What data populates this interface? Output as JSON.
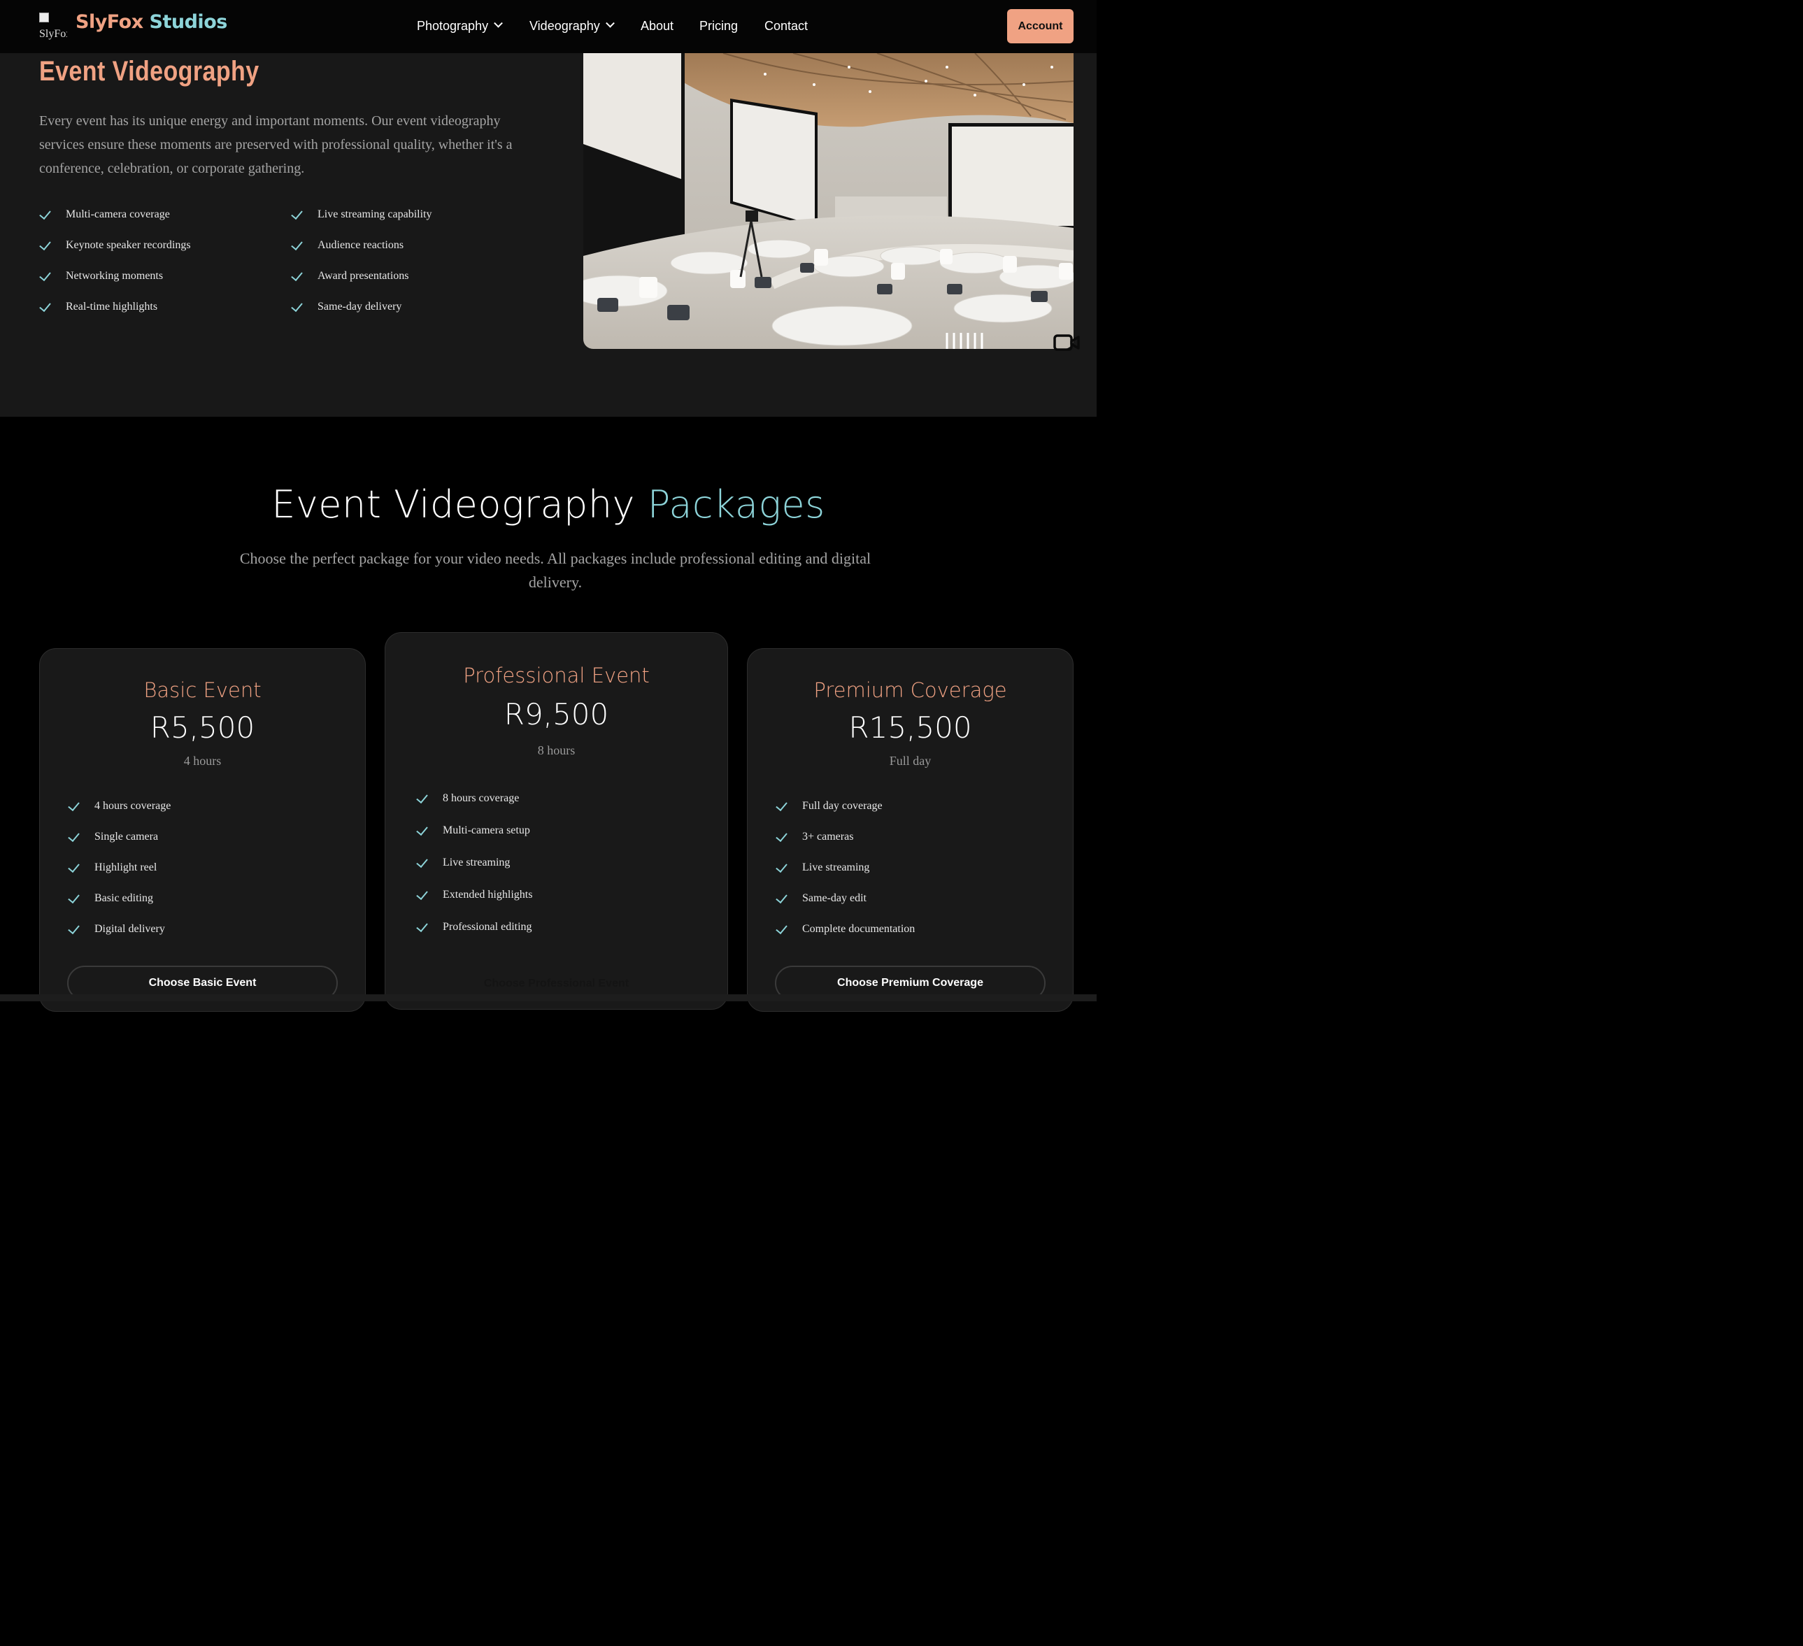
{
  "nav": {
    "logo_alt": "SlyFox Studios",
    "brand_first": "SlyFox",
    "brand_second": "Studios",
    "items": [
      {
        "label": "Photography",
        "dropdown": true
      },
      {
        "label": "Videography",
        "dropdown": true
      },
      {
        "label": "About",
        "dropdown": false
      },
      {
        "label": "Pricing",
        "dropdown": false
      },
      {
        "label": "Contact",
        "dropdown": false
      }
    ],
    "account_label": "Account"
  },
  "hero": {
    "title": "Event Videography",
    "description": "Every event has its unique energy and important moments. Our event videography services ensure these moments are preserved with professional quality, whether it's a conference, celebration, or corporate gathering.",
    "features": [
      "Multi-camera coverage",
      "Live streaming capability",
      "Keynote speaker recordings",
      "Audience reactions",
      "Networking moments",
      "Award presentations",
      "Real-time highlights",
      "Same-day delivery"
    ]
  },
  "packages": {
    "title_main": "Event Videography",
    "title_highlight": "Packages",
    "subtitle": "Choose the perfect package for your video needs. All packages include professional editing and digital delivery.",
    "cards": [
      {
        "name": "Basic Event",
        "price": "R5,500",
        "duration": "4 hours",
        "features": [
          "4 hours coverage",
          "Single camera",
          "Highlight reel",
          "Basic editing",
          "Digital delivery"
        ],
        "button": "Choose Basic Event"
      },
      {
        "name": "Professional Event",
        "price": "R9,500",
        "duration": "8 hours",
        "features": [
          "8 hours coverage",
          "Multi-camera setup",
          "Live streaming",
          "Extended highlights",
          "Professional editing"
        ],
        "button": "Choose Professional Event"
      },
      {
        "name": "Premium Coverage",
        "price": "R15,500",
        "duration": "Full day",
        "features": [
          "Full day coverage",
          "3+ cameras",
          "Live streaming",
          "Same-day edit",
          "Complete documentation"
        ],
        "button": "Choose Premium Coverage"
      }
    ]
  },
  "colors": {
    "accent_orange": "#f0a283",
    "accent_teal": "#8dd4d9",
    "background": "#000000",
    "panel": "#181818"
  },
  "icons": [
    "chevron-down-icon",
    "check-icon",
    "video-camera-icon",
    "broken-image-icon"
  ]
}
